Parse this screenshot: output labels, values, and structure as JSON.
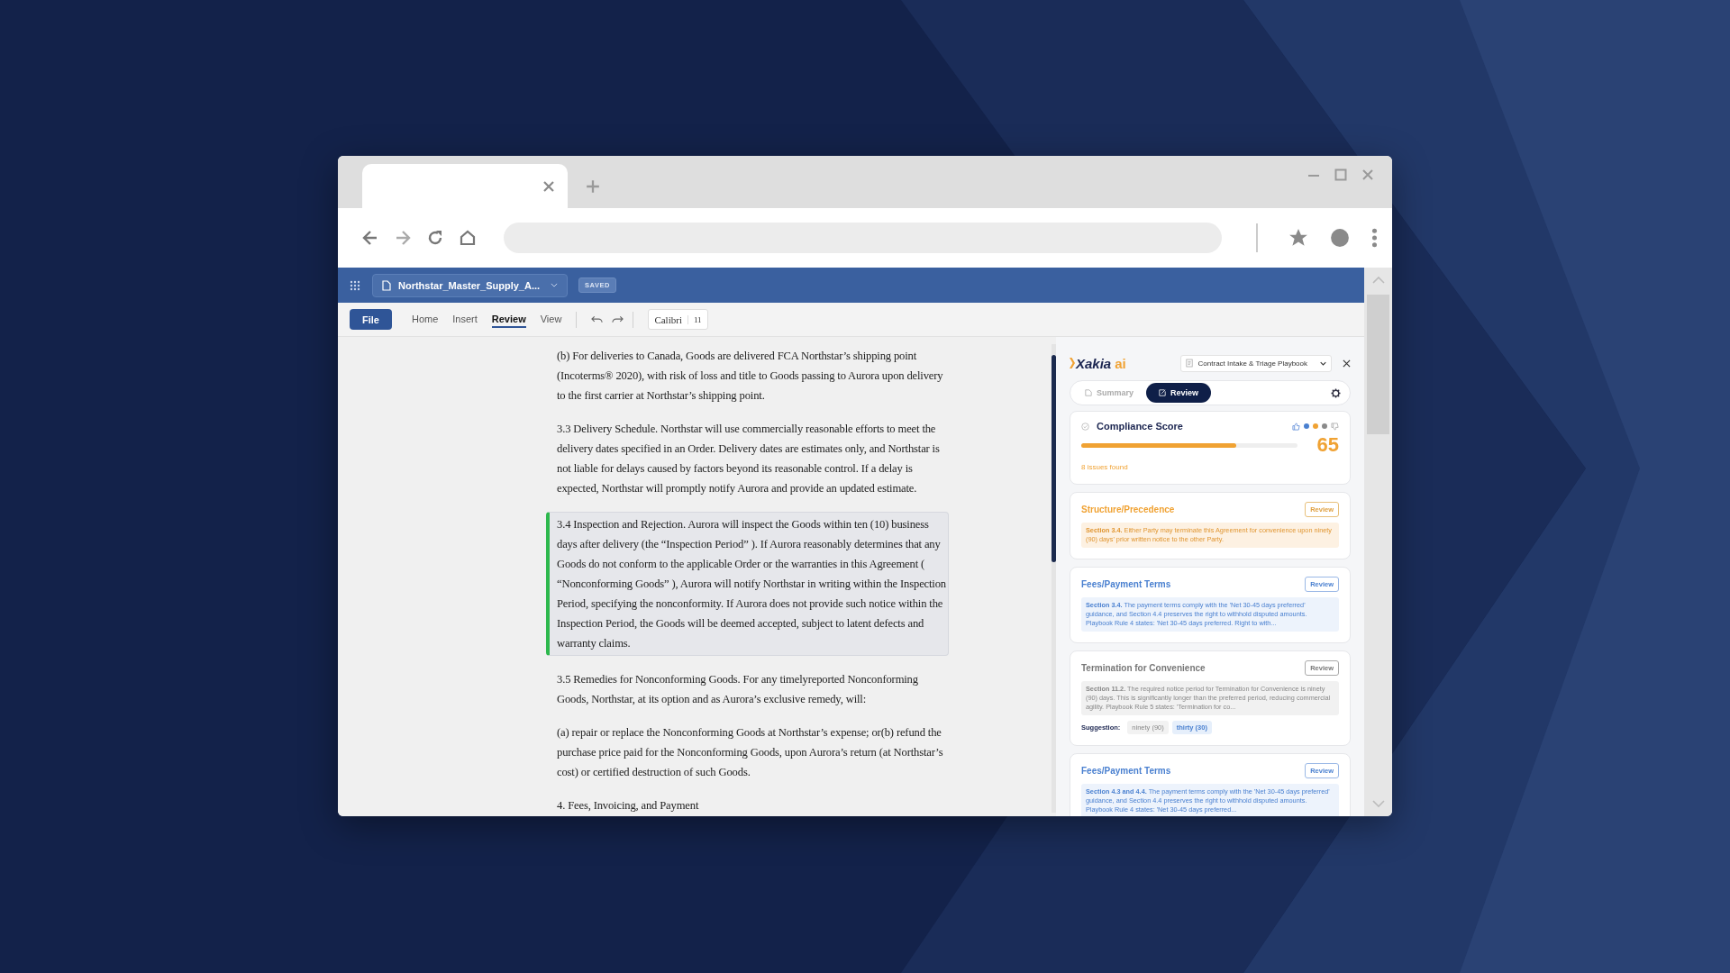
{
  "app": {
    "document_name": "Northstar_Master_Supply_A...",
    "save_status": "SAVED"
  },
  "menu": [
    {
      "label": "File",
      "kind": "button",
      "selected": false
    },
    {
      "label": "Home",
      "kind": "tab",
      "selected": false
    },
    {
      "label": "Insert",
      "kind": "tab",
      "selected": false
    },
    {
      "label": "Review",
      "kind": "tab",
      "selected": true
    },
    {
      "label": "View",
      "kind": "tab",
      "selected": false
    }
  ],
  "font": {
    "family": "Calibri",
    "size": "11"
  },
  "document": {
    "paragraphs": [
      {
        "text": "(b) For deliveries to Canada, Goods are delivered FCA Northstar’s shipping point (Incoterms® 2020), with risk of loss and title to Goods passing to Aurora upon delivery to the first carrier at Northstar’s shipping point.",
        "highlighted": false
      },
      {
        "text": "3.3 Delivery Schedule. Northstar will use commercially reasonable efforts to meet the delivery dates specified in an Order. Delivery dates are estimates only, and Northstar is not liable for delays caused by factors beyond its reasonable control. If a delay is expected, Northstar will promptly notify Aurora and provide an updated estimate.",
        "highlighted": false
      },
      {
        "text": "3.4 Inspection and Rejection. Aurora will inspect the Goods within ten (10) business days after delivery (the “Inspection Period” ). If Aurora reasonably determines that any Goods do not conform to the applicable Order or the warranties in this Agreement ( “Nonconforming Goods” ), Aurora will notify Northstar in writing within the Inspection Period, specifying the nonconformity. If Aurora does not provide such notice within the Inspection Period, the Goods will be deemed accepted, subject to latent defects and warranty claims.",
        "highlighted": true
      },
      {
        "text": "3.5 Remedies for Nonconforming Goods. For any timelyreported Nonconforming Goods, Northstar, at its option and as Aurora’s exclusive remedy, will:",
        "highlighted": false
      },
      {
        "text": "(a) repair or replace the Nonconforming Goods at Northstar’s expense; or(b) refund the purchase price paid for the Nonconforming Goods, upon Aurora’s return (at Northstar’s cost) or certified destruction of such Goods.",
        "highlighted": false
      },
      {
        "text": "4. Fees, Invoicing, and Payment",
        "highlighted": false
      }
    ]
  },
  "panel": {
    "brand": "Xakia",
    "brand_suffix": "ai",
    "playbook": "Contract Intake & Triage Playbook",
    "tabs": [
      {
        "label": "Summary",
        "selected": false
      },
      {
        "label": "Review",
        "selected": true
      }
    ],
    "score": {
      "title": "Compliance Score",
      "value": "65",
      "level": 0.72,
      "issues": "8 issues found",
      "dots": [
        {
          "color": "#4a80d0"
        },
        {
          "color": "#f0a233"
        },
        {
          "color": "#8a8a8a"
        }
      ]
    },
    "issues": [
      {
        "title": "Structure/Precedence",
        "kind": "warning",
        "action": "Review",
        "text": "**Section 3.4.** Either Party may terminate this Agreement for convenience upon ninety (90) days' prior written notice to the other Party."
      },
      {
        "title": "Fees/Payment Terms",
        "kind": "info",
        "action": "Review",
        "text": "**Section 3.4.** The payment terms comply with the 'Net 30-45 days preferred' guidance, and Section 4.4 preserves the right to withhold disputed amounts. Playbook Rule 4 states: 'Net 30-45 days preferred. Right to with..."
      },
      {
        "title": "Termination for Convenience",
        "kind": "neutral",
        "action": "Review",
        "text": "**Section 11.2.** The required notice period for Termination for Convenience is ninety (90) days. This is significantly longer than the preferred period, reducing commercial agility. Playbook Rule 5 states: 'Termination for co...",
        "suggestion": {
          "label": "Suggestion:",
          "options": [
            {
              "text": "ninety (90)",
              "selected": false
            },
            {
              "text": "thirty (30)",
              "selected": true
            }
          ]
        }
      },
      {
        "title": "Fees/Payment Terms",
        "kind": "info",
        "action": "Review",
        "text": "**Section 4.3 and 4.4.** The payment terms comply with the 'Net 30-45 days preferred' guidance, and Section 4.4 preserves the right to withhold disputed amounts. Playbook Rule 4 states: 'Net 30-45 days preferred..."
      }
    ]
  }
}
